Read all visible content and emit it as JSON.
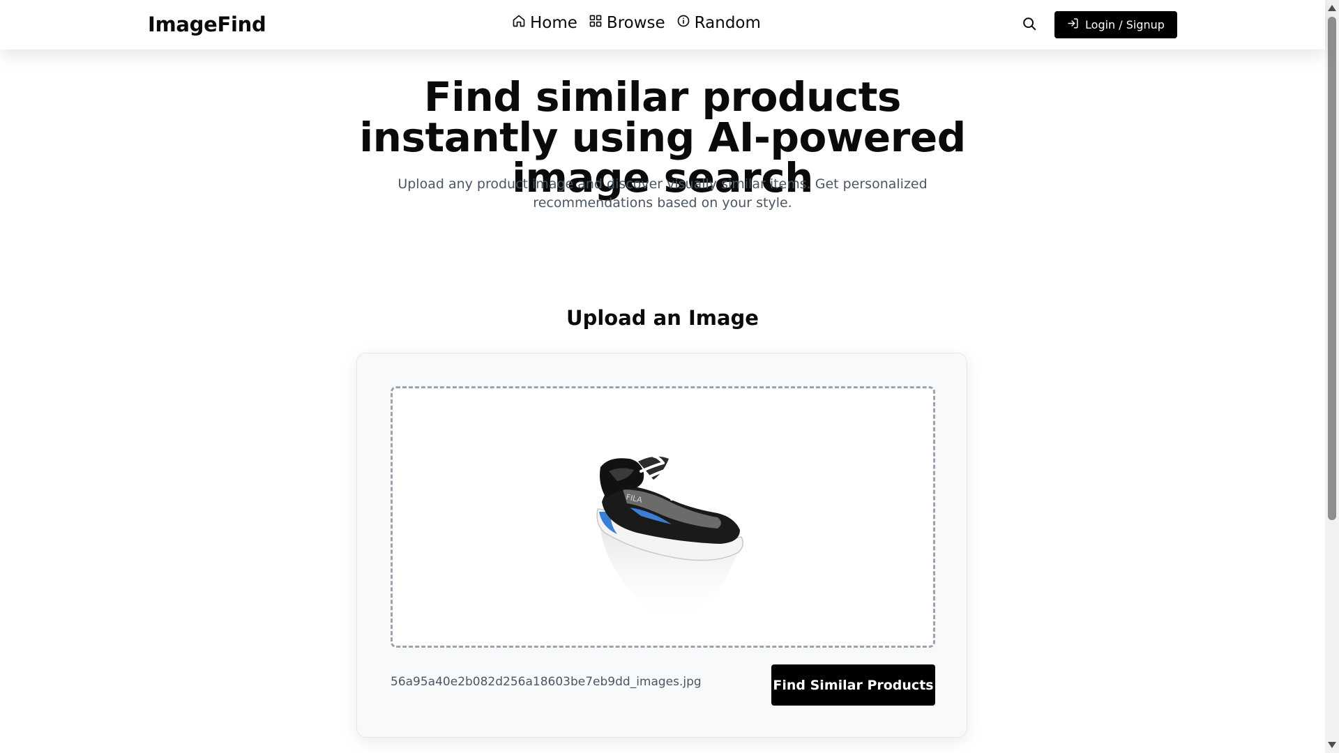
{
  "navbar": {
    "brand": "ImageFind",
    "links": [
      {
        "label": "Home",
        "icon": "home-icon"
      },
      {
        "label": "Browse",
        "icon": "grid-icon"
      },
      {
        "label": "Random",
        "icon": "info-icon"
      }
    ],
    "search_icon": "search-icon",
    "login_label": "Login / Signup",
    "login_icon": "log-in-icon"
  },
  "hero": {
    "title": "Find similar products instantly using AI-powered image search",
    "subtitle": "Upload any product image and discover visually similar items. Get personalized recommendations based on your style."
  },
  "upload": {
    "heading": "Upload an Image",
    "preview_alt": "uploaded running shoe preview",
    "filename": "56a95a40e2b082d256a18603be7eb9dd_images.jpg",
    "submit_label": "Find Similar Products"
  },
  "colors": {
    "primary": "#000000",
    "muted_text": "#4b5563",
    "card_background": "#f8f9fa",
    "dashed_border": "#9ca3af"
  }
}
